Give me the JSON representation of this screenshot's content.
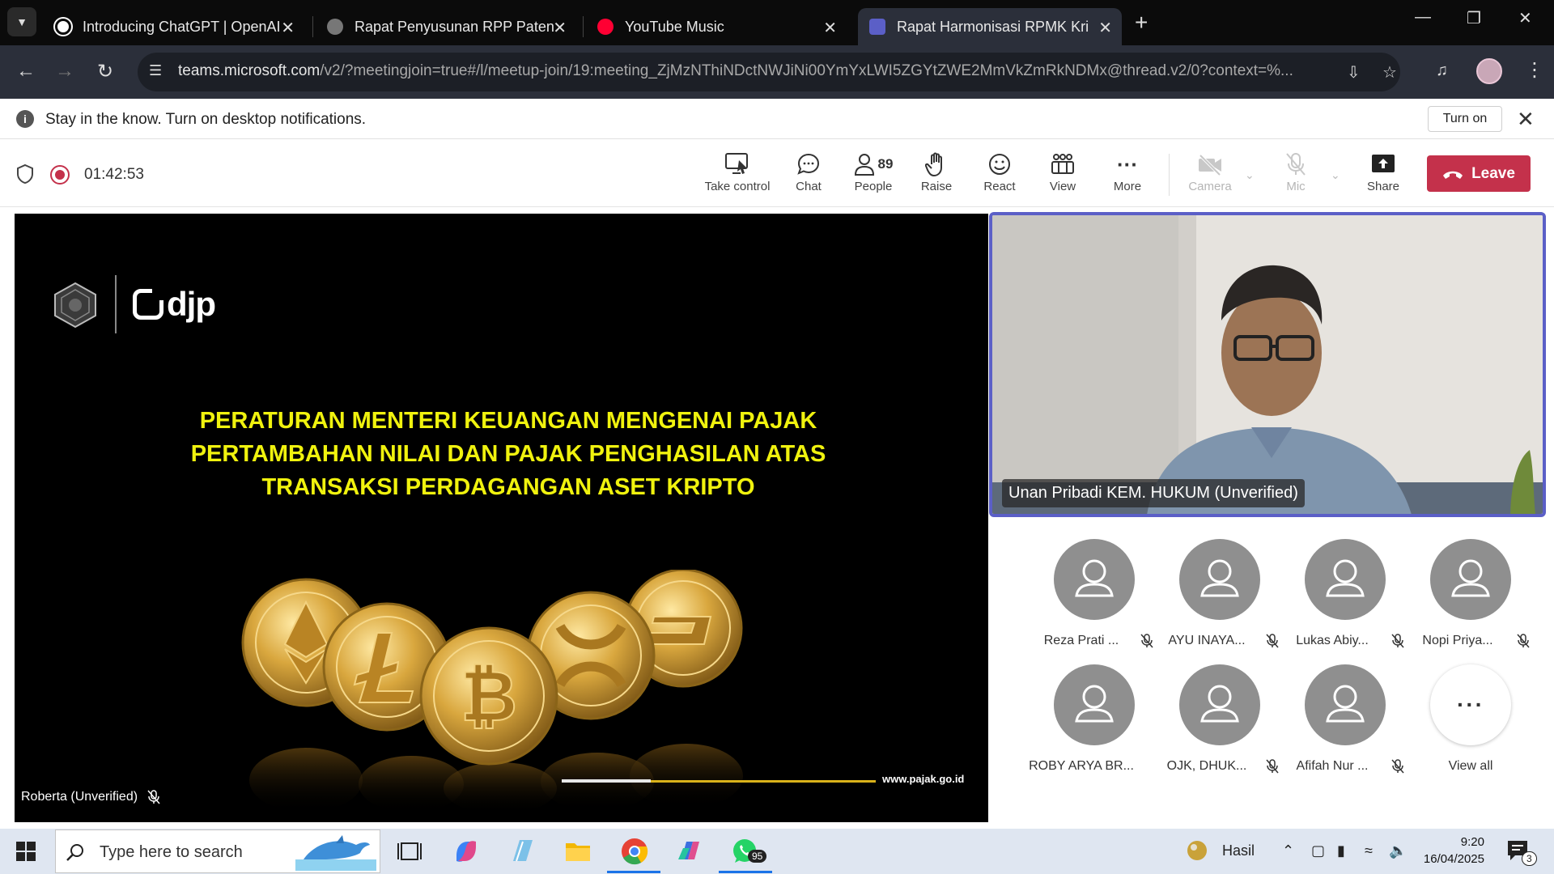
{
  "browser": {
    "tabs": [
      {
        "title": "Introducing ChatGPT | OpenAI"
      },
      {
        "title": "Rapat Penyusunan RPP Paten"
      },
      {
        "title": "YouTube Music"
      },
      {
        "title": "Rapat Harmonisasi RPMK Kripto"
      }
    ],
    "url_host": "teams.microsoft.com",
    "url_path": "/v2/?meetingjoin=true#/l/meetup-join/19:meeting_ZjMzNThiNDctNWJiNi00YmYxLWI5ZGYtZWE2MmVkZmRkNDMx@thread.v2/0?context=%..."
  },
  "notification": {
    "text": "Stay in the know. Turn on desktop notifications.",
    "button_label": "Turn on"
  },
  "meeting": {
    "timer": "01:42:53",
    "controls": {
      "take_control": "Take control",
      "chat": "Chat",
      "people": "People",
      "people_count": "89",
      "raise": "Raise",
      "react": "React",
      "view": "View",
      "more": "More",
      "camera": "Camera",
      "mic": "Mic",
      "share": "Share",
      "leave": "Leave"
    }
  },
  "slide": {
    "logo_text": "djp",
    "title": "PERATURAN MENTERI KEUANGAN MENGENAI PAJAK PERTAMBAHAN NILAI DAN PAJAK PENGHASILAN ATAS TRANSAKSI PERDAGANGAN ASET KRIPTO",
    "footer_url": "www.pajak.go.id",
    "presenter": "Roberta (Unverified)"
  },
  "speaker": {
    "name": "Unan Pribadi KEM. HUKUM (Unverified)"
  },
  "participants": [
    {
      "name": "Reza Prati ..."
    },
    {
      "name": "AYU INAYA..."
    },
    {
      "name": "Lukas Abiy..."
    },
    {
      "name": "Nopi Priya..."
    },
    {
      "name": "ROBY ARYA BR..."
    },
    {
      "name": "OJK, DHUK..."
    },
    {
      "name": "Afifah Nur ..."
    }
  ],
  "view_all_label": "View all",
  "taskbar": {
    "search_placeholder": "Type here to search",
    "whatsapp_badge": "95",
    "weather": "Hasil",
    "time": "9:20",
    "date": "16/04/2025",
    "notification_count": "3"
  },
  "colors": {
    "accent": "#5b5fc7",
    "leave": "#c4314b",
    "slide_title": "#f0f20e"
  }
}
